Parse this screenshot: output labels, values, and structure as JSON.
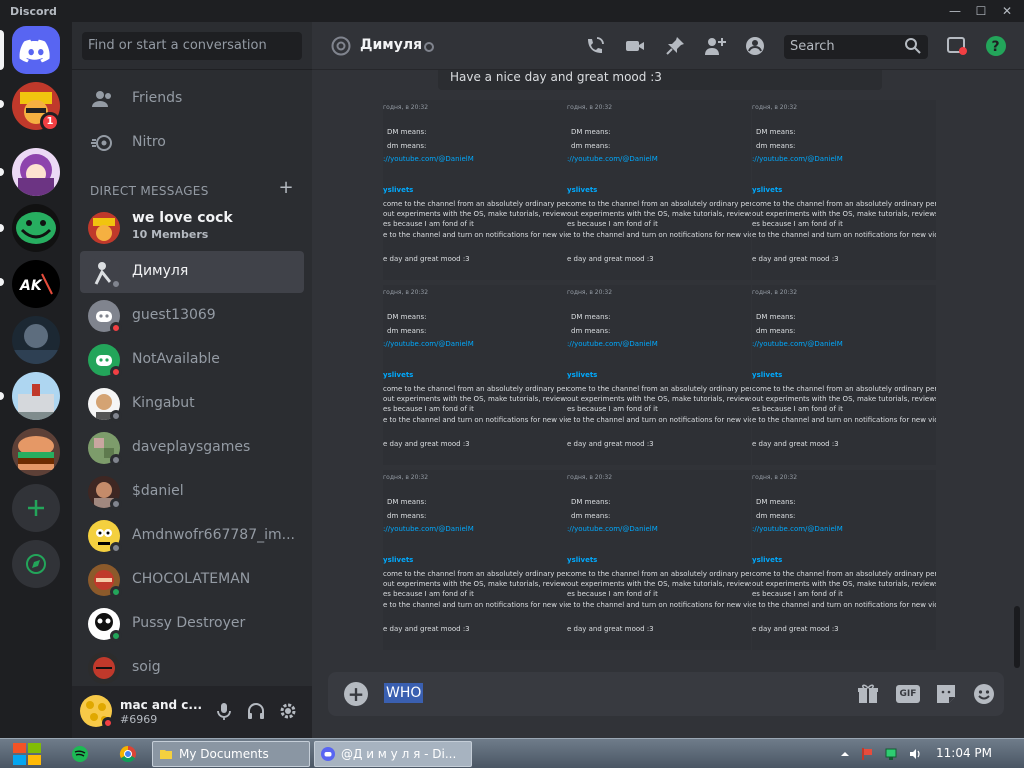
{
  "window": {
    "app_name": "Discord",
    "controls": {
      "minimize": "—",
      "maximize": "☐",
      "close": "✕"
    }
  },
  "servers": {
    "badge_count": "1",
    "items": [
      "burger-guy-server",
      "anime-girl-server",
      "trollface-server",
      "ak47-server",
      "moon-server",
      "building-server",
      "burger-server"
    ]
  },
  "sidebar": {
    "search_placeholder": "Find or start a conversation",
    "nav": [
      {
        "label": "Friends",
        "icon": "friends-icon"
      },
      {
        "label": "Nitro",
        "icon": "nitro-icon"
      }
    ],
    "dm_header": "DIRECT MESSAGES",
    "dm_add": "+",
    "dms": [
      {
        "name": "we love cock",
        "sub": "10 Members",
        "status": "none"
      },
      {
        "name": "Димуля",
        "status": "offline",
        "active": true
      },
      {
        "name": "guest13069",
        "status": "dnd"
      },
      {
        "name": "NotAvailable",
        "status": "dnd"
      },
      {
        "name": "Kingabut",
        "status": "offline"
      },
      {
        "name": "daveplaysgames",
        "status": "offline"
      },
      {
        "name": "$daniel",
        "status": "offline"
      },
      {
        "name": "Amdnwofr667787_im...",
        "status": "offline"
      },
      {
        "name": "CHOCOLATEMAN",
        "status": "online"
      },
      {
        "name": "Pussy Destroyer",
        "status": "online"
      },
      {
        "name": "soig",
        "status": "none"
      }
    ]
  },
  "user": {
    "name": "mac and c...",
    "tag": "#6969",
    "status": "dnd"
  },
  "channel": {
    "title": "Димуля",
    "search_placeholder": "Search"
  },
  "messages": {
    "previous": "Have a nice day and great mood :3",
    "tile_lines": {
      "timestamp": "годня, в 20:32",
      "l1": "DM means:",
      "l2": "dm means:",
      "link": "://youtube.com/@DanielM",
      "heading": "yslivets",
      "p1": "come to the channel from an absolutely ordinary person! Here",
      "p2": "out experiments with the OS, make tutorials, reviews and other",
      "p3": "es because I am fond of it",
      "p4": "e to the channel and turn on notifications for new videos, I hope",
      "p5": "e day and great mood :3"
    }
  },
  "composer": {
    "text": "WHO",
    "gif": "GIF"
  },
  "taskbar": {
    "windows": [
      {
        "label": "My Documents"
      },
      {
        "label": "@Д и м у л я - Di..."
      }
    ],
    "clock": "11:04 PM"
  },
  "colors": {
    "blurple": "#5865f2",
    "online": "#23a55a",
    "dnd": "#f23f43",
    "offline": "#80848e",
    "link": "#00a8fc"
  }
}
